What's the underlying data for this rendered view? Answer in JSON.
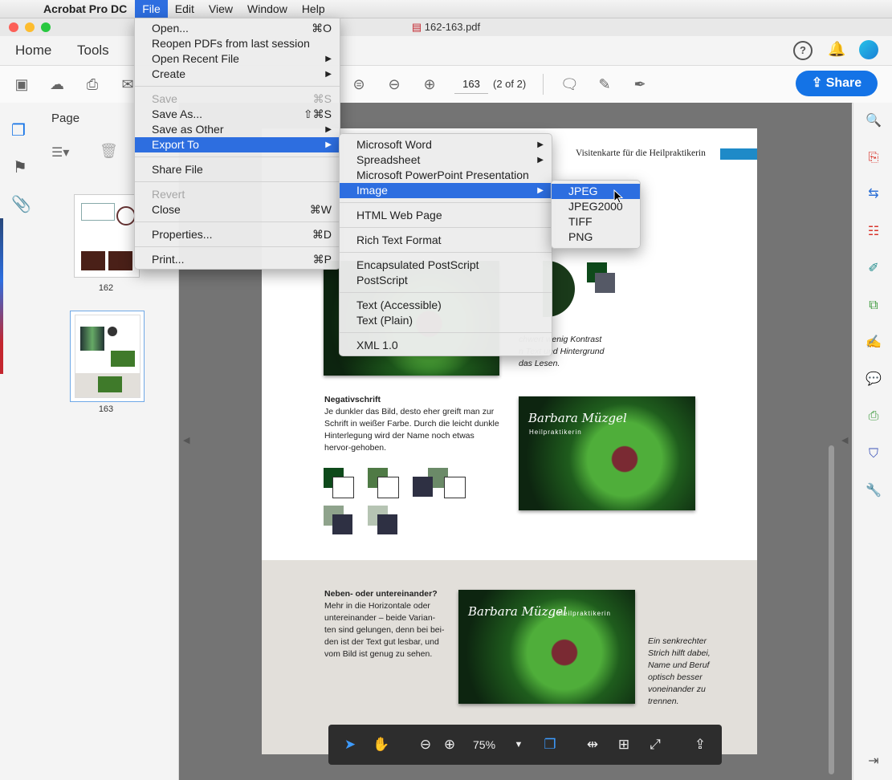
{
  "menubar": {
    "app_name": "Acrobat Pro DC",
    "items": [
      "File",
      "Edit",
      "View",
      "Window",
      "Help"
    ]
  },
  "window": {
    "title": "162-163.pdf"
  },
  "topnav": {
    "home": "Home",
    "tools": "Tools"
  },
  "toolbar": {
    "page_number": "163",
    "page_count": "(2 of 2)",
    "share_label": "Share"
  },
  "left_panel": {
    "title": "Page",
    "thumbnails": [
      {
        "label": "162"
      },
      {
        "label": "163"
      }
    ]
  },
  "file_menu": {
    "items": [
      {
        "label": "Open...",
        "shortcut": "⌘O"
      },
      {
        "label": "Reopen PDFs from last session",
        "shortcut": ""
      },
      {
        "label": "Open Recent File",
        "submenu": true
      },
      {
        "label": "Create",
        "submenu": true
      },
      {
        "label": "Save",
        "shortcut": "⌘S",
        "disabled": true
      },
      {
        "label": "Save As...",
        "shortcut": "⇧⌘S"
      },
      {
        "label": "Save as Other",
        "submenu": true
      },
      {
        "label": "Export To",
        "submenu": true,
        "highlighted": true
      },
      {
        "label": "Share File"
      },
      {
        "label": "Revert",
        "disabled": true
      },
      {
        "label": "Close",
        "shortcut": "⌘W"
      },
      {
        "label": "Properties...",
        "shortcut": "⌘D"
      },
      {
        "label": "Print...",
        "shortcut": "⌘P"
      }
    ]
  },
  "export_menu": {
    "items": [
      {
        "label": "Microsoft Word",
        "submenu": true
      },
      {
        "label": "Spreadsheet",
        "submenu": true
      },
      {
        "label": "Microsoft PowerPoint Presentation"
      },
      {
        "label": "Image",
        "submenu": true,
        "highlighted": true
      },
      {
        "label": "HTML Web Page"
      },
      {
        "label": "Rich Text Format"
      },
      {
        "label": "Encapsulated PostScript"
      },
      {
        "label": "PostScript"
      },
      {
        "label": "Text (Accessible)"
      },
      {
        "label": "Text (Plain)"
      },
      {
        "label": "XML 1.0"
      }
    ]
  },
  "image_menu": {
    "items": [
      {
        "label": "JPEG",
        "highlighted": true
      },
      {
        "label": "JPEG2000"
      },
      {
        "label": "TIFF"
      },
      {
        "label": "PNG"
      }
    ]
  },
  "document": {
    "header": "Visitenkarte für die Heilpraktikerin",
    "note1": "chwert wenig Kontrast\nn Text und Hintergrund\ndas Lesen.",
    "neg_title": "Negativschrift",
    "neg_body": "Je dunkler das Bild, desto eher greift man zur Schrift in weißer Farbe. Durch die leicht dunkle Hinterlegung wird der Name noch etwas hervor-gehoben.",
    "card_name": "Barbara Müzgel",
    "card_sub": "Heilpraktikerin",
    "card2_name": "Barbara Müzgel",
    "card2_sub": "| Heilpraktikerin",
    "side_title": "Neben- oder untereinander?",
    "side_body": "Mehr in die Horizontale oder untereinander – beide Varian-ten sind gelungen, denn bei bei-den ist der Text gut lesbar, und vom Bild ist genug zu sehen.",
    "side_note": "Ein senkrechter Strich hilft dabei, Name und Beruf optisch besser voneinander zu trennen."
  },
  "floatbar": {
    "zoom": "75%"
  },
  "colors": {
    "accent": "#2d6ee0",
    "share": "#1473e6",
    "brand_red": "#c4262e"
  }
}
